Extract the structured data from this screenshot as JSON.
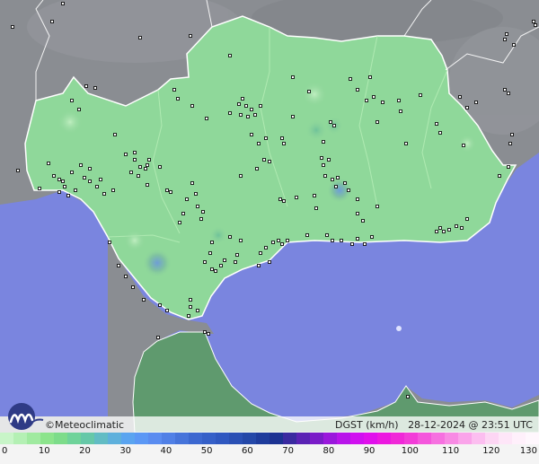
{
  "map": {
    "legend": {
      "brand": "Meteoclimatic",
      "copyright_symbol": "©",
      "variable": "DGST (km/h)",
      "timestamp": "28-12-2024 @ 23:51 UTC"
    },
    "scale": {
      "ticks": [
        "0",
        "10",
        "20",
        "30",
        "40",
        "50",
        "60",
        "70",
        "80",
        "90",
        "100",
        "110",
        "120",
        "130"
      ],
      "colors": [
        "#c8f5c8",
        "#b4f0b4",
        "#a0eaa0",
        "#8ce48c",
        "#7ddc8a",
        "#6fd39a",
        "#66c8a8",
        "#62bcc4",
        "#5eb0dc",
        "#5aa4f0",
        "#5b98f5",
        "#5a8cf0",
        "#5080e6",
        "#4674da",
        "#3c68d0",
        "#3560c8",
        "#2f58c0",
        "#2a50b4",
        "#2448a8",
        "#1e3c9c",
        "#1c3292",
        "#3a2aa0",
        "#5a22b4",
        "#7a1cc8",
        "#9a18dc",
        "#b814ea",
        "#d010f0",
        "#e010ec",
        "#ec18e0",
        "#f028d8",
        "#f23cd8",
        "#f456dc",
        "#f670e0",
        "#f88ae4",
        "#faa4ea",
        "#fcbef0",
        "#fdd6f4",
        "#fee6f8",
        "#fff0fb",
        "#fff7fd"
      ]
    },
    "stations_icon": "station-marker-icon"
  }
}
